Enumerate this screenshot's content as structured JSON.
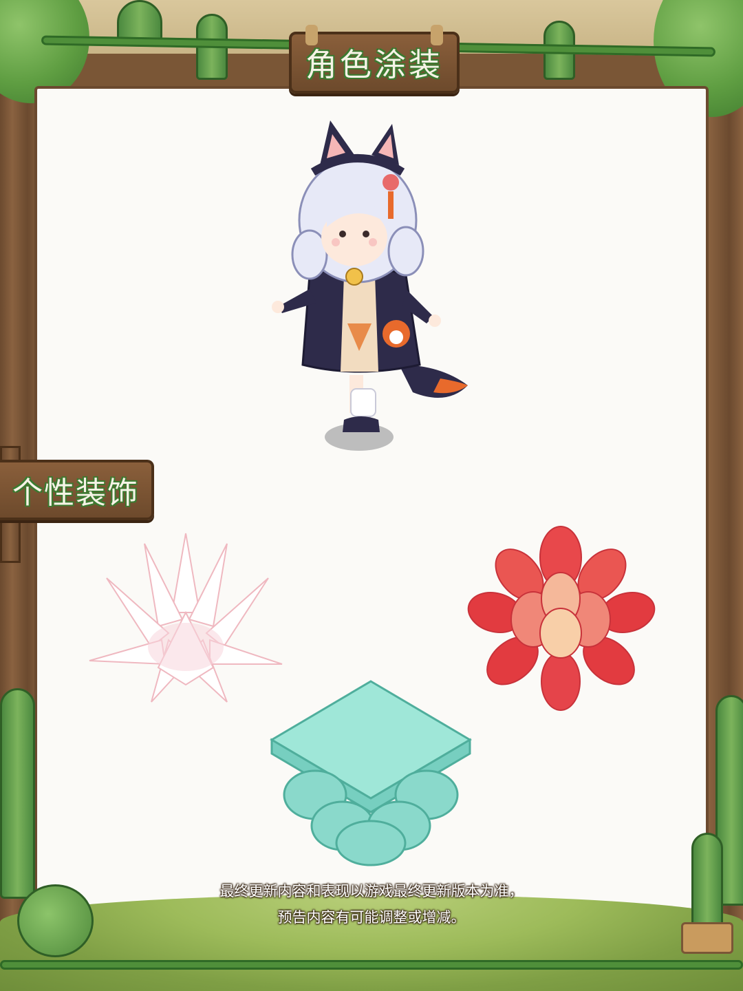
{
  "header": {
    "title": "角色涂装"
  },
  "section": {
    "title": "个性装饰"
  },
  "items": [
    {
      "name": "character-skin",
      "icon": "chibi-character-fox-outfit"
    },
    {
      "name": "white-succulent",
      "icon": "white-agave-icon"
    },
    {
      "name": "red-succulent",
      "icon": "red-succulent-icon"
    },
    {
      "name": "teal-pedestal",
      "icon": "lotus-pedestal-icon"
    }
  ],
  "footer": {
    "line1": "最终更新内容和表现以游戏最终更新版本为准，",
    "line2": "预告内容有可能调整或增减。"
  },
  "colors": {
    "wood": "#6b4a2f",
    "panel": "#fbfaf7",
    "title_text": "#f6f3e6",
    "title_outline": "#3b7a30",
    "grass": "#9dbb5a"
  }
}
